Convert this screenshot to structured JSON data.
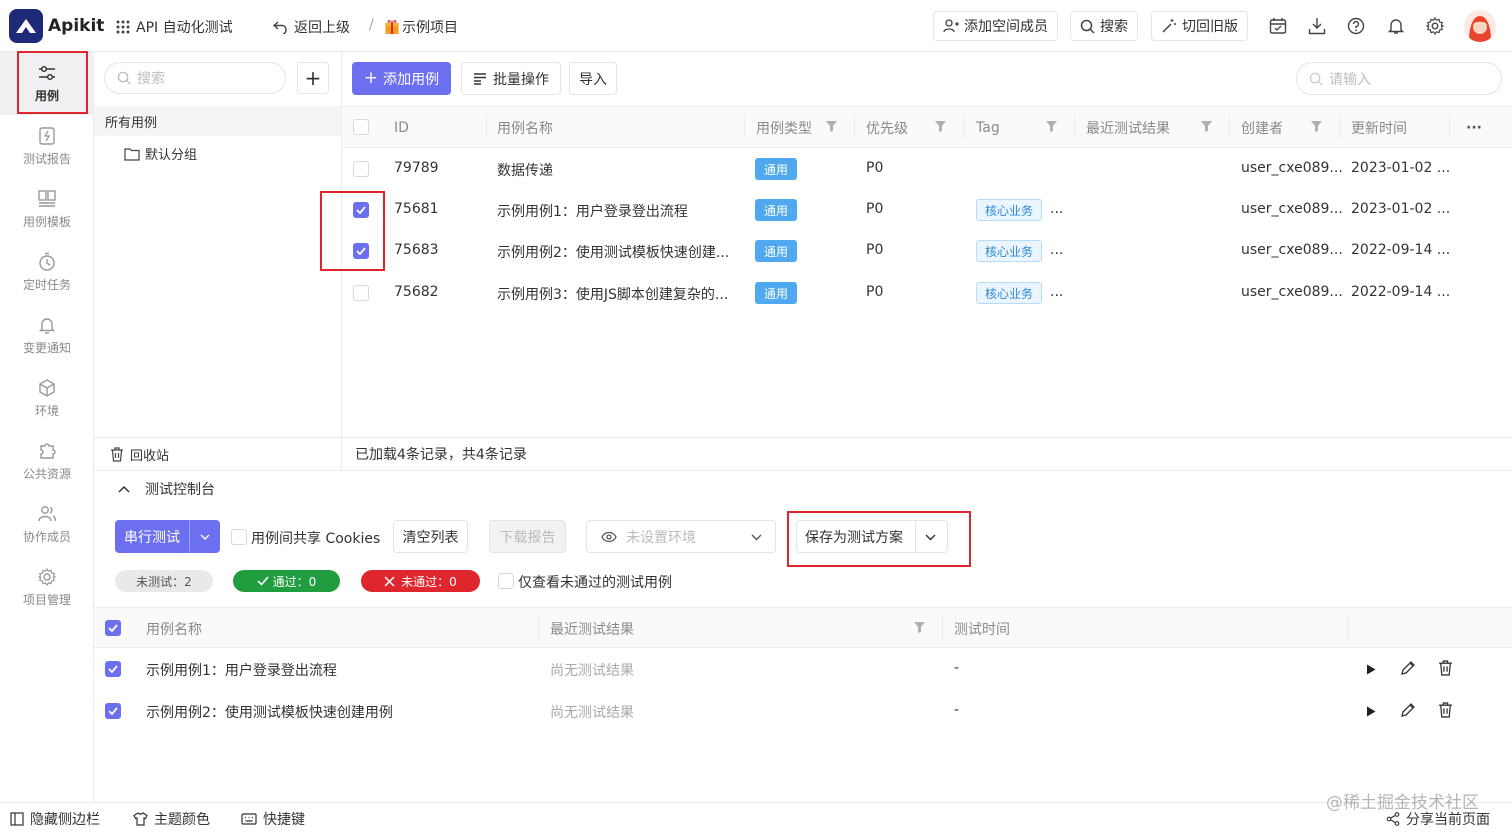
{
  "app": {
    "name": "Apikit",
    "workspace": "API 自动化测试",
    "back_label": "返回上级",
    "breadcrumb_sep": "/",
    "project": "示例项目"
  },
  "topbar": {
    "add_member": "添加空间成员",
    "search": "搜索",
    "switch_old": "切回旧版"
  },
  "rail": [
    {
      "label": "用例",
      "icon": "sliders-icon"
    },
    {
      "label": "测试报告",
      "icon": "report-icon"
    },
    {
      "label": "用例模板",
      "icon": "template-icon"
    },
    {
      "label": "定时任务",
      "icon": "timer-icon"
    },
    {
      "label": "变更通知",
      "icon": "bell-icon"
    },
    {
      "label": "环境",
      "icon": "cube-icon"
    },
    {
      "label": "公共资源",
      "icon": "puzzle-icon"
    },
    {
      "label": "协作成员",
      "icon": "users-icon"
    },
    {
      "label": "项目管理",
      "icon": "gear-icon"
    }
  ],
  "tree": {
    "search_placeholder": "搜索",
    "add": "+",
    "all_cases": "所有用例",
    "default_group": "默认分组",
    "recycle": "回收站"
  },
  "toolbar": {
    "add_case": "添加用例",
    "batch": "批量操作",
    "import": "导入",
    "search_placeholder": "请输入"
  },
  "table": {
    "headers": [
      "ID",
      "用例名称",
      "用例类型",
      "优先级",
      "Tag",
      "最近测试结果",
      "创建者",
      "更新时间"
    ],
    "more": "···",
    "rows": [
      {
        "id": "79789",
        "name": "数据传递",
        "type": "通用",
        "priority": "P0",
        "tag": "",
        "tag_more": "",
        "creator": "user_cxe089...",
        "updated": "2023-01-02 ..."
      },
      {
        "id": "75681",
        "name": "示例用例1：用户登录登出流程",
        "type": "通用",
        "priority": "P0",
        "tag": "核心业务",
        "tag_more": "...",
        "creator": "user_cxe089...",
        "updated": "2023-01-02 ..."
      },
      {
        "id": "75683",
        "name": "示例用例2：使用测试模板快速创建...",
        "type": "通用",
        "priority": "P0",
        "tag": "核心业务",
        "tag_more": "...",
        "creator": "user_cxe089...",
        "updated": "2022-09-14 ..."
      },
      {
        "id": "75682",
        "name": "示例用例3：使用JS脚本创建复杂的...",
        "type": "通用",
        "priority": "P0",
        "tag": "核心业务",
        "tag_more": "...",
        "creator": "user_cxe089...",
        "updated": "2022-09-14 ..."
      }
    ],
    "footer": "已加载4条记录，共4条记录"
  },
  "console": {
    "title": "测试控制台",
    "run_mode": "串行测试",
    "share_cookies": "用例间共享 Cookies",
    "clear": "清空列表",
    "download": "下载报告",
    "env_placeholder": "未设置环境",
    "save_plan": "保存为测试方案",
    "untested": "未测试：2",
    "passed": "通过：0",
    "failed": "未通过：0",
    "only_failed": "仅查看未通过的测试用例",
    "headers": [
      "用例名称",
      "最近测试结果",
      "测试时间"
    ],
    "rows": [
      {
        "name": "示例用例1：用户登录登出流程",
        "result": "尚无测试结果",
        "time": "-"
      },
      {
        "name": "示例用例2：使用测试模板快速创建用例",
        "result": "尚无测试结果",
        "time": "-"
      }
    ]
  },
  "bottombar": {
    "hide_sidebar": "隐藏侧边栏",
    "theme": "主题颜色",
    "shortcuts": "快捷键",
    "share": "分享当前页面",
    "watermark": "@稀土掘金技术社区"
  },
  "colors": {
    "accent": "#6b6ff0",
    "type_badge": "#50a9ef",
    "pass": "#1f9d3f",
    "fail": "#e0262d",
    "highlight": "#e0262d"
  }
}
